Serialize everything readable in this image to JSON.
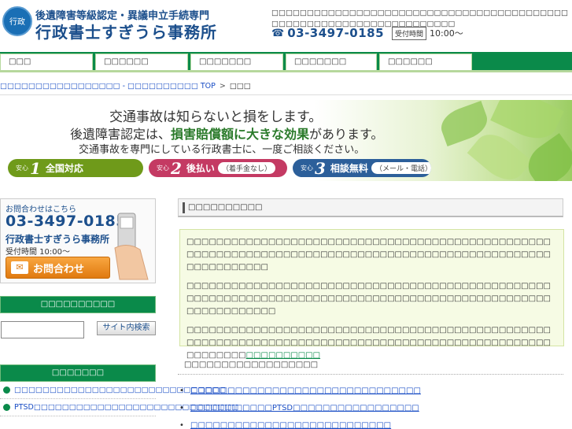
{
  "header": {
    "logo_emblem": "行政",
    "logo_line1": "後遺障害等級認定・異議申立手続専門",
    "logo_line2": "行政書士すぎうら事務所",
    "description": "□□□□□□□□□□□□□□□□□□□□□□□□□□□□□□□□□□□□□□□□□□□□□□□□□□□□□□□□□□□□□□□□□□□□",
    "phone_icon": "☎",
    "phone": "03-3497-0185",
    "hours_badge": "受付時間",
    "hours": "10:00〜"
  },
  "nav": {
    "items": [
      {
        "label": "□□□"
      },
      {
        "label": "□□□□□□"
      },
      {
        "label": "□□□□□□□"
      },
      {
        "label": "□□□□□□□"
      },
      {
        "label": "□□□□□□"
      }
    ]
  },
  "breadcrumb": {
    "home": "□□□□□□□□□□□□□□□□□ - □□□□□□□□□□ TOP",
    "sep": ">",
    "current": "□□□"
  },
  "banner": {
    "line1": "交通事故は知らないと損をします。",
    "line2_a": "後遺障害認定は、",
    "line2_b": "損害賠償額に大きな効果",
    "line2_c": "があります。",
    "line3": "交通事故を専門にしている行政書士に、一度ご相談ください。",
    "pills": [
      {
        "an": "安心",
        "num": "1",
        "label": "全国対応",
        "small": "",
        "color": "#6f9a1a"
      },
      {
        "an": "安心",
        "num": "2",
        "label": "後払い",
        "small": "（着手金なし）",
        "color": "#c43a63"
      },
      {
        "an": "安心",
        "num": "3",
        "label": "相談無料",
        "small": "（メール・電話）",
        "color": "#2c5f9a"
      }
    ]
  },
  "sidebar": {
    "contact_label": "お問合わせはこちら",
    "contact_phone": "03-3497-0185",
    "office": "行政書士すぎうら事務所",
    "hours": "受付時間 10:00〜",
    "contact_button": "お問合わせ",
    "search_heading": "□□□□□□□□□□",
    "search_button": "サイト内検索",
    "links_heading": "□□□□□□□",
    "links": [
      {
        "label": "□□□□□□□□□□□□□□□□□□□□□□□□□□□□□□"
      },
      {
        "label": "PTSD□□□□□□□□□□□□□□□□□□□□□□□□□□□□□"
      }
    ]
  },
  "main": {
    "heading": "□□□□□□□□□□",
    "paragraphs": [
      "□□□□□□□□□□□□□□□□□□□□□□□□□□□□□□□□□□□□□□□□□□□□□□□□□□□□□□□□□□□□□□□□□□□□□□□□□□□□□□□□□□□□□□□□□□□□□□□□□□□□□□□□□□□□□",
      "□□□□□□□□□□□□□□□□□□□□□□□□□□□□□□□□□□□□□□□□□□□□□□□□□□□□□□□□□□□□□□□□□□□□□□□□□□□□□□□□□□□□□□□□□□□□□□□□□□□□□□□□□□□□□□",
      "□□□□□□□□□□□□□□□□□□□□□□□□□□□□□□□□□□□□□□□□□□□□□□□□□□□□□□□□□□□□□□□□□□□□□□□□□□□□□□□□□□□□□□□□□□□□□□□□□□□□□□□□□□"
    ],
    "para3_link": "□□□□□□□□□□",
    "subheading": "□□□□□□□□□□□□□□□□□□",
    "list": [
      {
        "label": "□□□□□□□□□□□□□□□□□□□□□□□□□□□□□□□"
      },
      {
        "label": "□□□□□□□□□□□PTSD□□□□□□□□□□□□□□□□□"
      },
      {
        "label": "□□□□□□□□□□□□□□□□□□□□□□□□□□□"
      }
    ]
  }
}
